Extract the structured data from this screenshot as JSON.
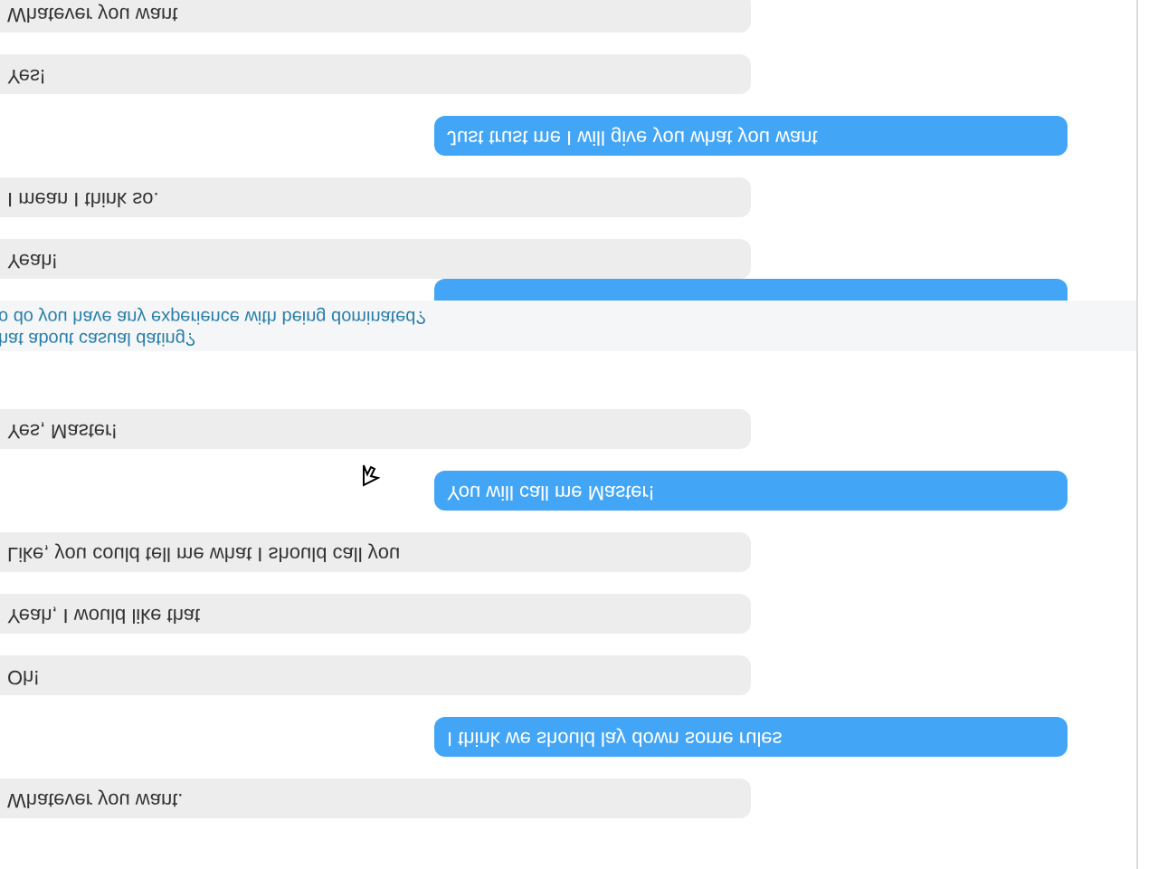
{
  "messages_above": [
    {
      "kind": "received",
      "text": "Whatever you want"
    },
    {
      "kind": "received",
      "text": "Yes!"
    },
    {
      "kind": "sent",
      "text": "Just trust me I will give you what you want"
    },
    {
      "kind": "received",
      "text": "I mean I think so."
    },
    {
      "kind": "received",
      "text": "Yeah!"
    }
  ],
  "suggestions": [
    "o do you have any experience with being dominated?",
    "hat about casual dating?"
  ],
  "messages_below": [
    {
      "kind": "received",
      "text": "Yes, Master!"
    },
    {
      "kind": "sent",
      "text": "You will call me Master!"
    },
    {
      "kind": "received",
      "text": "Like, you could tell me what I should call you"
    },
    {
      "kind": "received",
      "text": "Yeah, I would like that"
    },
    {
      "kind": "received",
      "text": "Oh!"
    },
    {
      "kind": "sent",
      "text": "I think we should lay down some rules"
    },
    {
      "kind": "received",
      "text": "Whatever you want."
    }
  ]
}
